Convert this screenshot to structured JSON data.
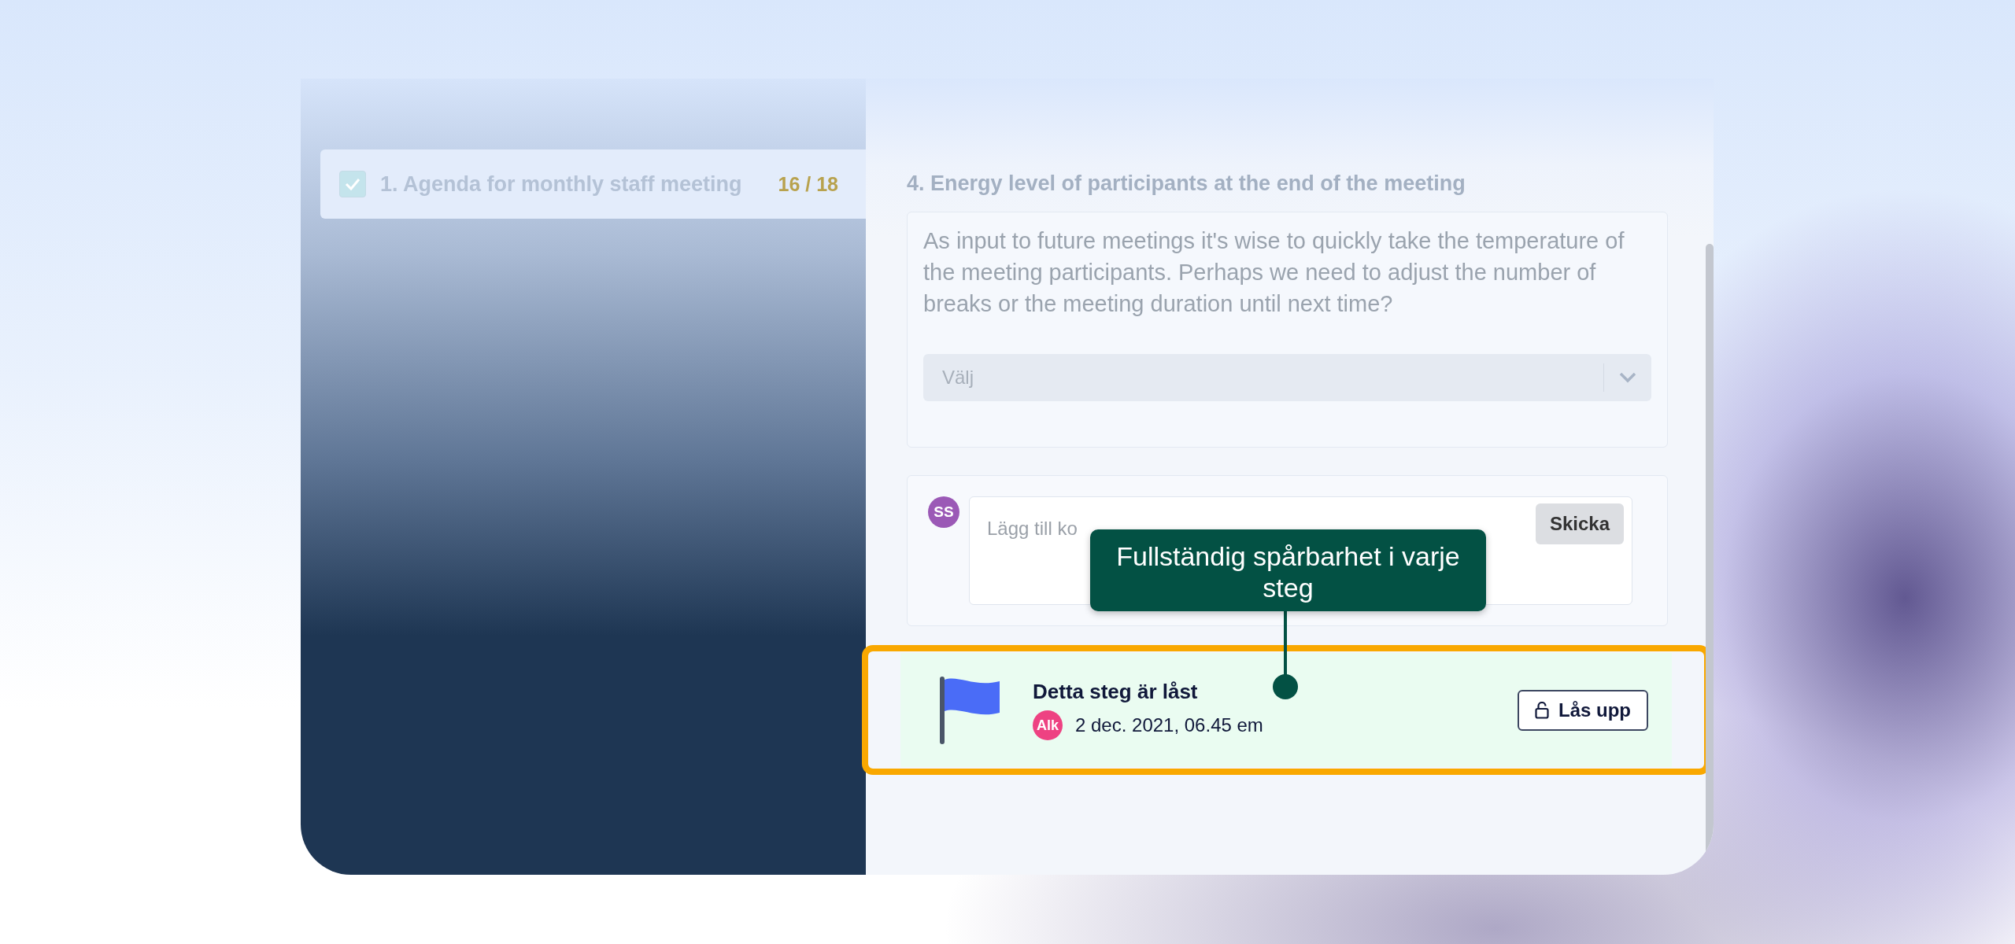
{
  "agenda_item": {
    "label": "1. Agenda for monthly staff meeting",
    "checked": true,
    "progress": "16 / 18"
  },
  "question": {
    "title": "4. Energy level of participants at the end of the meeting",
    "description": "As input to future meetings it's wise to quickly take the temperature of the meeting participants. Perhaps we need to adjust the number of breaks or the meeting duration until next time?",
    "select": {
      "placeholder": "Välj"
    }
  },
  "comment": {
    "avatar": {
      "initials": "SS",
      "color": "#9b59b6"
    },
    "placeholder": "Lägg till ko",
    "button": "Skicka"
  },
  "tooltip": {
    "text": "Fullständig spårbarhet i varje steg"
  },
  "locked_step": {
    "title": "Detta steg är låst",
    "avatar": {
      "initials": "Alk",
      "color": "#ee4282"
    },
    "date": "2 dec. 2021, 06.45 em",
    "button": "Lås upp"
  }
}
